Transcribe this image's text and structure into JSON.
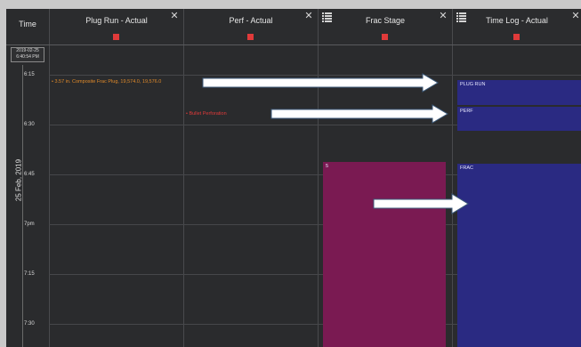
{
  "time_column": {
    "title": "Time",
    "date_box_line1": "2019-02-25",
    "date_box_line2": "6:40:54 PM",
    "date_side": "25 Feb, 2019",
    "labels": [
      "6:15",
      "6:30",
      "6:45",
      "7pm",
      "7:15",
      "7:30"
    ]
  },
  "columns": [
    {
      "title": "Plug Run - Actual",
      "has_close": true,
      "has_list_icon": false
    },
    {
      "title": "Perf - Actual",
      "has_close": true,
      "has_list_icon": false
    },
    {
      "title": "Frac Stage",
      "has_close": true,
      "has_list_icon": true
    },
    {
      "title": "Time Log - Actual",
      "has_close": true,
      "has_list_icon": true
    }
  ],
  "events": {
    "plug_run": "• 3.57 in. Composite Frac Plug, 19,574.0, 19,576.0",
    "perforation": "• Bullet Perforation"
  },
  "frac_stage": {
    "label": "5"
  },
  "time_log": [
    {
      "label": "PLUG RUN"
    },
    {
      "label": "PERF"
    },
    {
      "label": "FRAC"
    }
  ],
  "colors": {
    "plug_run_text": "#e08a2a",
    "perf_text": "#e03a3a",
    "frac_block": "#7a1a52",
    "timelog_block": "#2a2a82",
    "marker": "#e03a3a",
    "arrow": "#ffffff"
  },
  "icons": [
    "close-icon",
    "list-icon",
    "arrow-right-icon"
  ]
}
